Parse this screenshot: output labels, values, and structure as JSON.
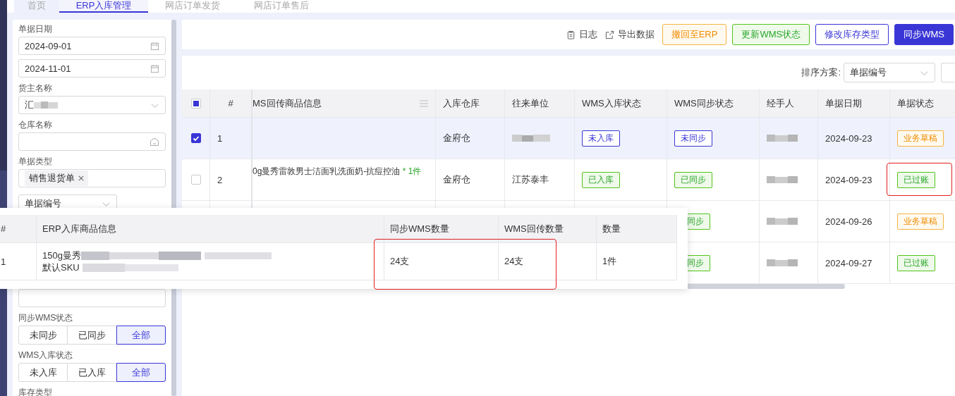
{
  "tabs": [
    {
      "label": "首页",
      "selected": false
    },
    {
      "label": "ERP入库管理",
      "selected": true
    },
    {
      "label": "网店订单发货",
      "selected": false
    },
    {
      "label": "网店订单售后",
      "selected": false
    }
  ],
  "filters": {
    "date_label": "单据日期",
    "date_from": "2024-09-01",
    "date_to": "2024-11-01",
    "owner_label": "货主名称",
    "owner_value": "汇",
    "warehouse_label": "仓库名称",
    "doc_type_label": "单据类型",
    "doc_type_tags": [
      "销售退货单"
    ],
    "doc_no_select": "单据编号",
    "sync_label": "同步WMS状态",
    "sync_options": [
      {
        "label": "未同步",
        "selected": false
      },
      {
        "label": "已同步",
        "selected": false
      },
      {
        "label": "全部",
        "selected": true
      }
    ],
    "inbound_label": "WMS入库状态",
    "inbound_options": [
      {
        "label": "未入库",
        "selected": false
      },
      {
        "label": "已入库",
        "selected": false
      },
      {
        "label": "全部",
        "selected": true
      }
    ],
    "stock_type_label": "库存类型"
  },
  "toolbar": {
    "links": [
      {
        "kind": "log",
        "label": "日志"
      },
      {
        "kind": "export",
        "label": "导出数据"
      }
    ],
    "buttons": [
      {
        "kind": "warning",
        "label": "撤回至ERP"
      },
      {
        "kind": "success",
        "label": "更新WMS状态"
      },
      {
        "kind": "outline",
        "label": "修改库存类型"
      },
      {
        "kind": "primary",
        "label": "同步WMS"
      }
    ]
  },
  "sort": {
    "label": "排序方案:",
    "value": "单据编号"
  },
  "table": {
    "indeterminate": true,
    "columns": [
      "#",
      "MS回传商品信息",
      "入库仓库",
      "往来单位",
      "WMS入库状态",
      "WMS同步状态",
      "经手人",
      "单据日期",
      "单据状态"
    ],
    "rows": [
      {
        "selected": true,
        "checked": true,
        "index": "1",
        "warehouse": "金府仓",
        "wms_in": {
          "label": "未入库",
          "kind": "blue"
        },
        "wms_sync": {
          "label": "未同步",
          "kind": "blue"
        },
        "date": "2024-09-23",
        "status": {
          "label": "业务草稿",
          "kind": "orange"
        }
      },
      {
        "selected": false,
        "checked": false,
        "index": "2",
        "product": "0g曼秀雷敦男士洁面乳洗面奶-抗痘控油",
        "product_qty": " * 1件",
        "warehouse": "金府仓",
        "partner": "江苏泰丰",
        "wms_in": {
          "label": "已入库",
          "kind": "green"
        },
        "wms_sync": {
          "label": "已同步",
          "kind": "green"
        },
        "date": "2024-09-23",
        "status": {
          "label": "已过账",
          "kind": "green"
        }
      },
      {
        "selected": false,
        "wms_sync_partial": {
          "label": "同步",
          "kind": "green"
        },
        "date": "2024-09-26",
        "status": {
          "label": "业务草稿",
          "kind": "orange"
        }
      },
      {
        "selected": false,
        "wms_sync_partial": {
          "label": "同步",
          "kind": "green"
        },
        "date": "2024-09-27",
        "status": {
          "label": "已过账",
          "kind": "green"
        }
      }
    ]
  },
  "popup": {
    "columns": [
      "#",
      "ERP入库商品信息",
      "同步WMS数量",
      "WMS回传数量",
      "数量"
    ],
    "rows": [
      {
        "index": "1",
        "product": "150g曼秀",
        "sku_label": "默认SKU",
        "sync_qty": "24支",
        "return_qty": "24支",
        "qty": "1件"
      }
    ]
  }
}
